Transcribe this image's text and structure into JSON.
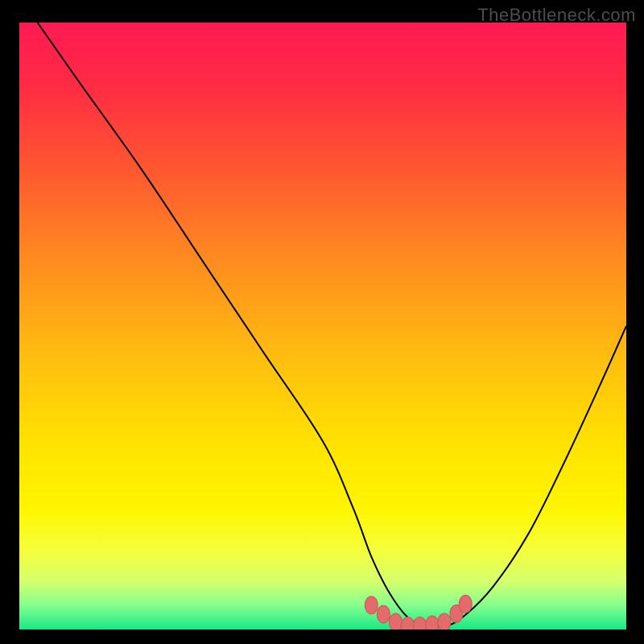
{
  "watermark": "TheBottleneck.com",
  "colors": {
    "page_bg": "#000000",
    "watermark": "#4d4d4d",
    "gradient_stops": [
      {
        "offset": 0.0,
        "color": "#ff1a53"
      },
      {
        "offset": 0.1,
        "color": "#ff2a44"
      },
      {
        "offset": 0.25,
        "color": "#ff5a2f"
      },
      {
        "offset": 0.4,
        "color": "#ff8e1f"
      },
      {
        "offset": 0.55,
        "color": "#ffbd10"
      },
      {
        "offset": 0.7,
        "color": "#ffe400"
      },
      {
        "offset": 0.8,
        "color": "#fff500"
      },
      {
        "offset": 0.87,
        "color": "#f4ff3a"
      },
      {
        "offset": 0.92,
        "color": "#d6ff6e"
      },
      {
        "offset": 0.96,
        "color": "#86ff8e"
      },
      {
        "offset": 1.0,
        "color": "#17e884"
      }
    ],
    "curve_stroke": "#000000",
    "marker_fill": "#e46b6b",
    "marker_stroke": "#cf5454"
  },
  "chart_data": {
    "type": "line",
    "title": "",
    "xlabel": "",
    "ylabel": "",
    "xlim": [
      0,
      100
    ],
    "ylim": [
      0,
      100
    ],
    "grid": false,
    "series": [
      {
        "name": "bottleneck-curve",
        "x": [
          3,
          10,
          20,
          30,
          40,
          50,
          55,
          58,
          61,
          64,
          67,
          70,
          73,
          78,
          84,
          90,
          96,
          100
        ],
        "y": [
          100,
          90,
          76,
          61,
          46,
          31,
          20,
          12,
          6,
          2,
          0.5,
          0.5,
          2,
          7,
          16,
          28,
          41,
          50
        ]
      }
    ],
    "markers": {
      "name": "highlight-cluster",
      "points": [
        {
          "x": 58,
          "y": 4.0
        },
        {
          "x": 60,
          "y": 2.5
        },
        {
          "x": 62,
          "y": 1.2
        },
        {
          "x": 64,
          "y": 0.6
        },
        {
          "x": 66,
          "y": 0.6
        },
        {
          "x": 68,
          "y": 0.8
        },
        {
          "x": 70,
          "y": 1.2
        },
        {
          "x": 72,
          "y": 2.6
        },
        {
          "x": 73.5,
          "y": 4.2
        }
      ]
    }
  }
}
